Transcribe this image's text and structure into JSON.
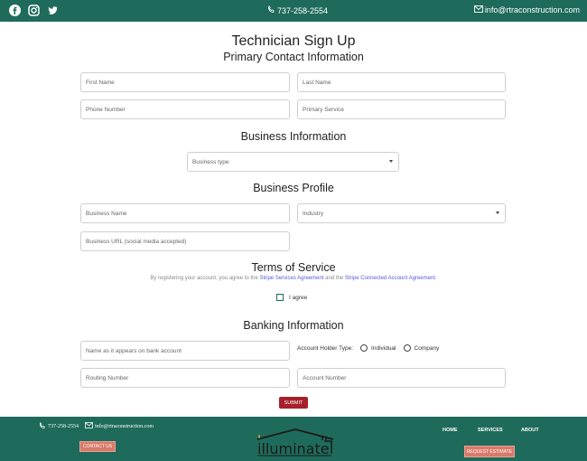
{
  "topbar": {
    "icons": [
      "facebook-icon",
      "instagram-icon",
      "twitter-icon"
    ],
    "phone": "737-258-2554",
    "email": "info@rtraconstruction.com"
  },
  "form": {
    "title": "Technician Sign Up",
    "primary_contact_heading": "Primary Contact Information",
    "first_name_placeholder": "First Name",
    "last_name_placeholder": "Last Name",
    "phone_placeholder": "Phone Number",
    "primary_service_placeholder": "Primary Service",
    "business_info_heading": "Business Information",
    "business_type_value": "Business type",
    "business_profile_heading": "Business Profile",
    "business_name_placeholder": "Business Name",
    "industry_value": "Industry",
    "business_url_placeholder": "Business URL (social media accepted)",
    "tos_heading": "Terms of Service",
    "tos_prefix": "By registering your account, you agree to the",
    "tos_link1": "Stripe Services Agreement",
    "tos_middle": "and the",
    "tos_link2": "Stripe Connected Account Agreement",
    "tos_suffix": ".",
    "agree_label": "I agree",
    "banking_heading": "Banking Information",
    "account_name_placeholder": "Name as it appears on bank account",
    "account_holder_label": "Account Holder Type:",
    "holder_option_individual": "Individual",
    "holder_option_company": "Company",
    "routing_placeholder": "Routing Number",
    "account_number_placeholder": "Account Number",
    "submit_label": "SUBMIT"
  },
  "footer": {
    "phone": "737-258-2554",
    "email": "info@rtraconstruction.com",
    "contact_button": "CONTACT US",
    "logo_text": "illuminate",
    "nav": [
      "HOME",
      "SERVICES",
      "ABOUT"
    ],
    "estimate_button": "REQUEST ESTIMATE"
  },
  "colors": {
    "brand_green": "#1f6b5b",
    "submit_red": "#a5202a",
    "accent_salmon": "#d97a6a",
    "link_blue": "#5a5ad8"
  }
}
